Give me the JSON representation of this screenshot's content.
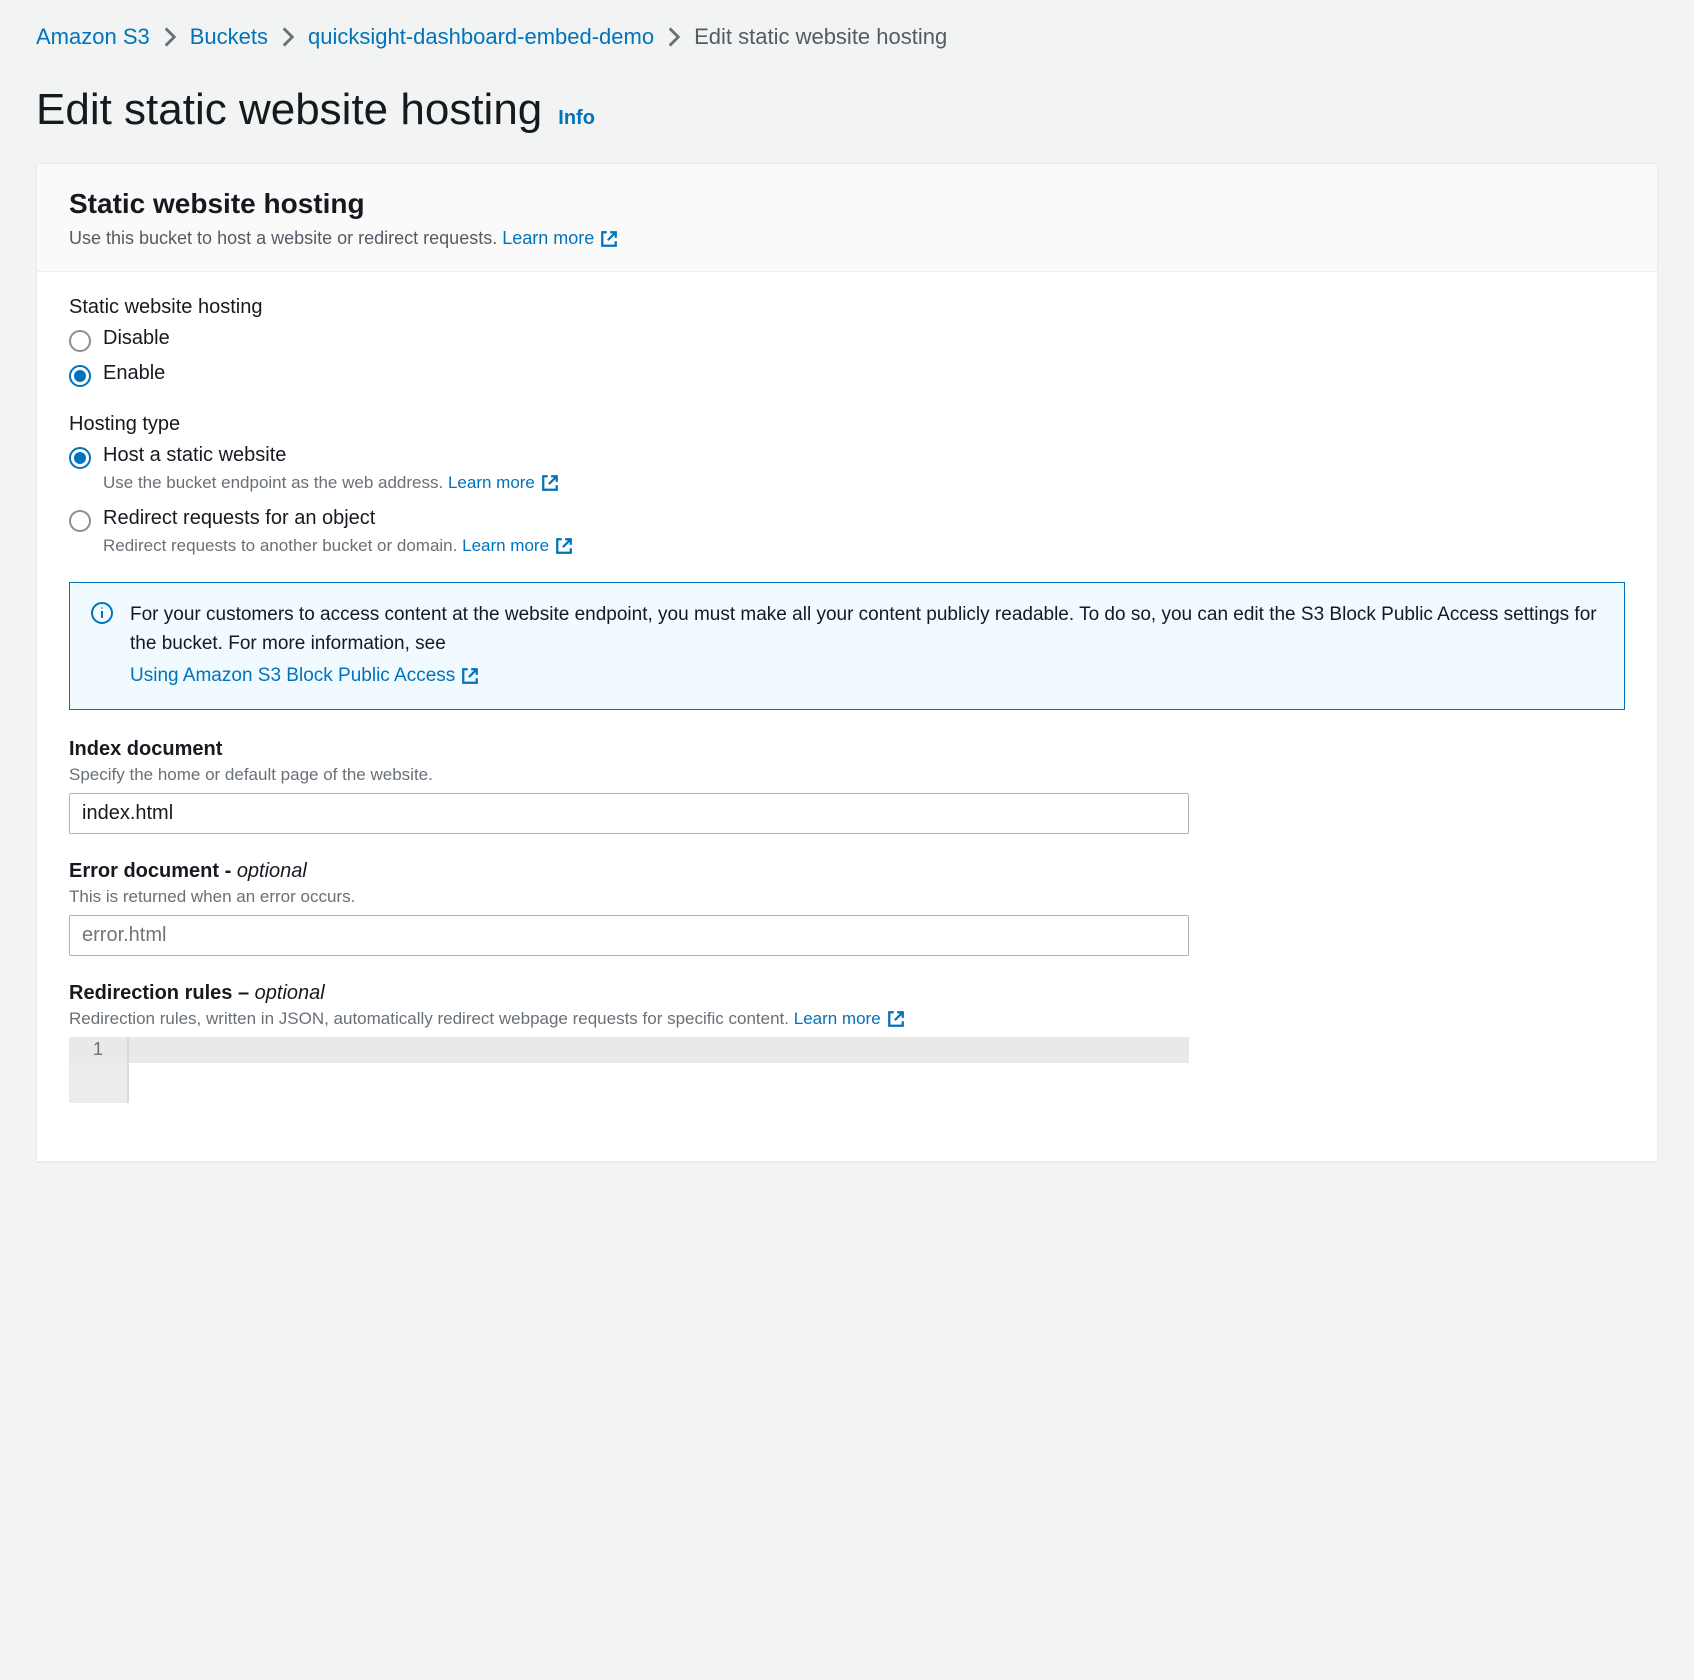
{
  "breadcrumbs": {
    "service": "Amazon S3",
    "buckets": "Buckets",
    "bucket_name": "quicksight-dashboard-embed-demo",
    "current": "Edit static website hosting"
  },
  "page": {
    "title": "Edit static website hosting",
    "info": "Info"
  },
  "panel": {
    "title": "Static website hosting",
    "desc": "Use this bucket to host a website or redirect requests.",
    "learn_more": "Learn more"
  },
  "hosting": {
    "label": "Static website hosting",
    "options": {
      "disable": "Disable",
      "enable": "Enable"
    }
  },
  "hosting_type": {
    "label": "Hosting type",
    "static": {
      "label": "Host a static website",
      "desc": "Use the bucket endpoint as the web address.",
      "learn_more": "Learn more"
    },
    "redirect": {
      "label": "Redirect requests for an object",
      "desc": "Redirect requests to another bucket or domain.",
      "learn_more": "Learn more"
    }
  },
  "alert": {
    "text": "For your customers to access content at the website endpoint, you must make all your content publicly readable. To do so, you can edit the S3 Block Public Access settings for the bucket. For more information, see",
    "link": "Using Amazon S3 Block Public Access"
  },
  "index_doc": {
    "label": "Index document",
    "hint": "Specify the home or default page of the website.",
    "value": "index.html"
  },
  "error_doc": {
    "label_main": "Error document",
    "label_sep": " - ",
    "label_optional": "optional",
    "hint": "This is returned when an error occurs.",
    "placeholder": "error.html"
  },
  "redirect_rules": {
    "label_main": "Redirection rules",
    "label_sep": " – ",
    "label_optional": "optional",
    "hint": "Redirection rules, written in JSON, automatically redirect webpage requests for specific content.",
    "learn_more": "Learn more",
    "line_number": "1"
  }
}
